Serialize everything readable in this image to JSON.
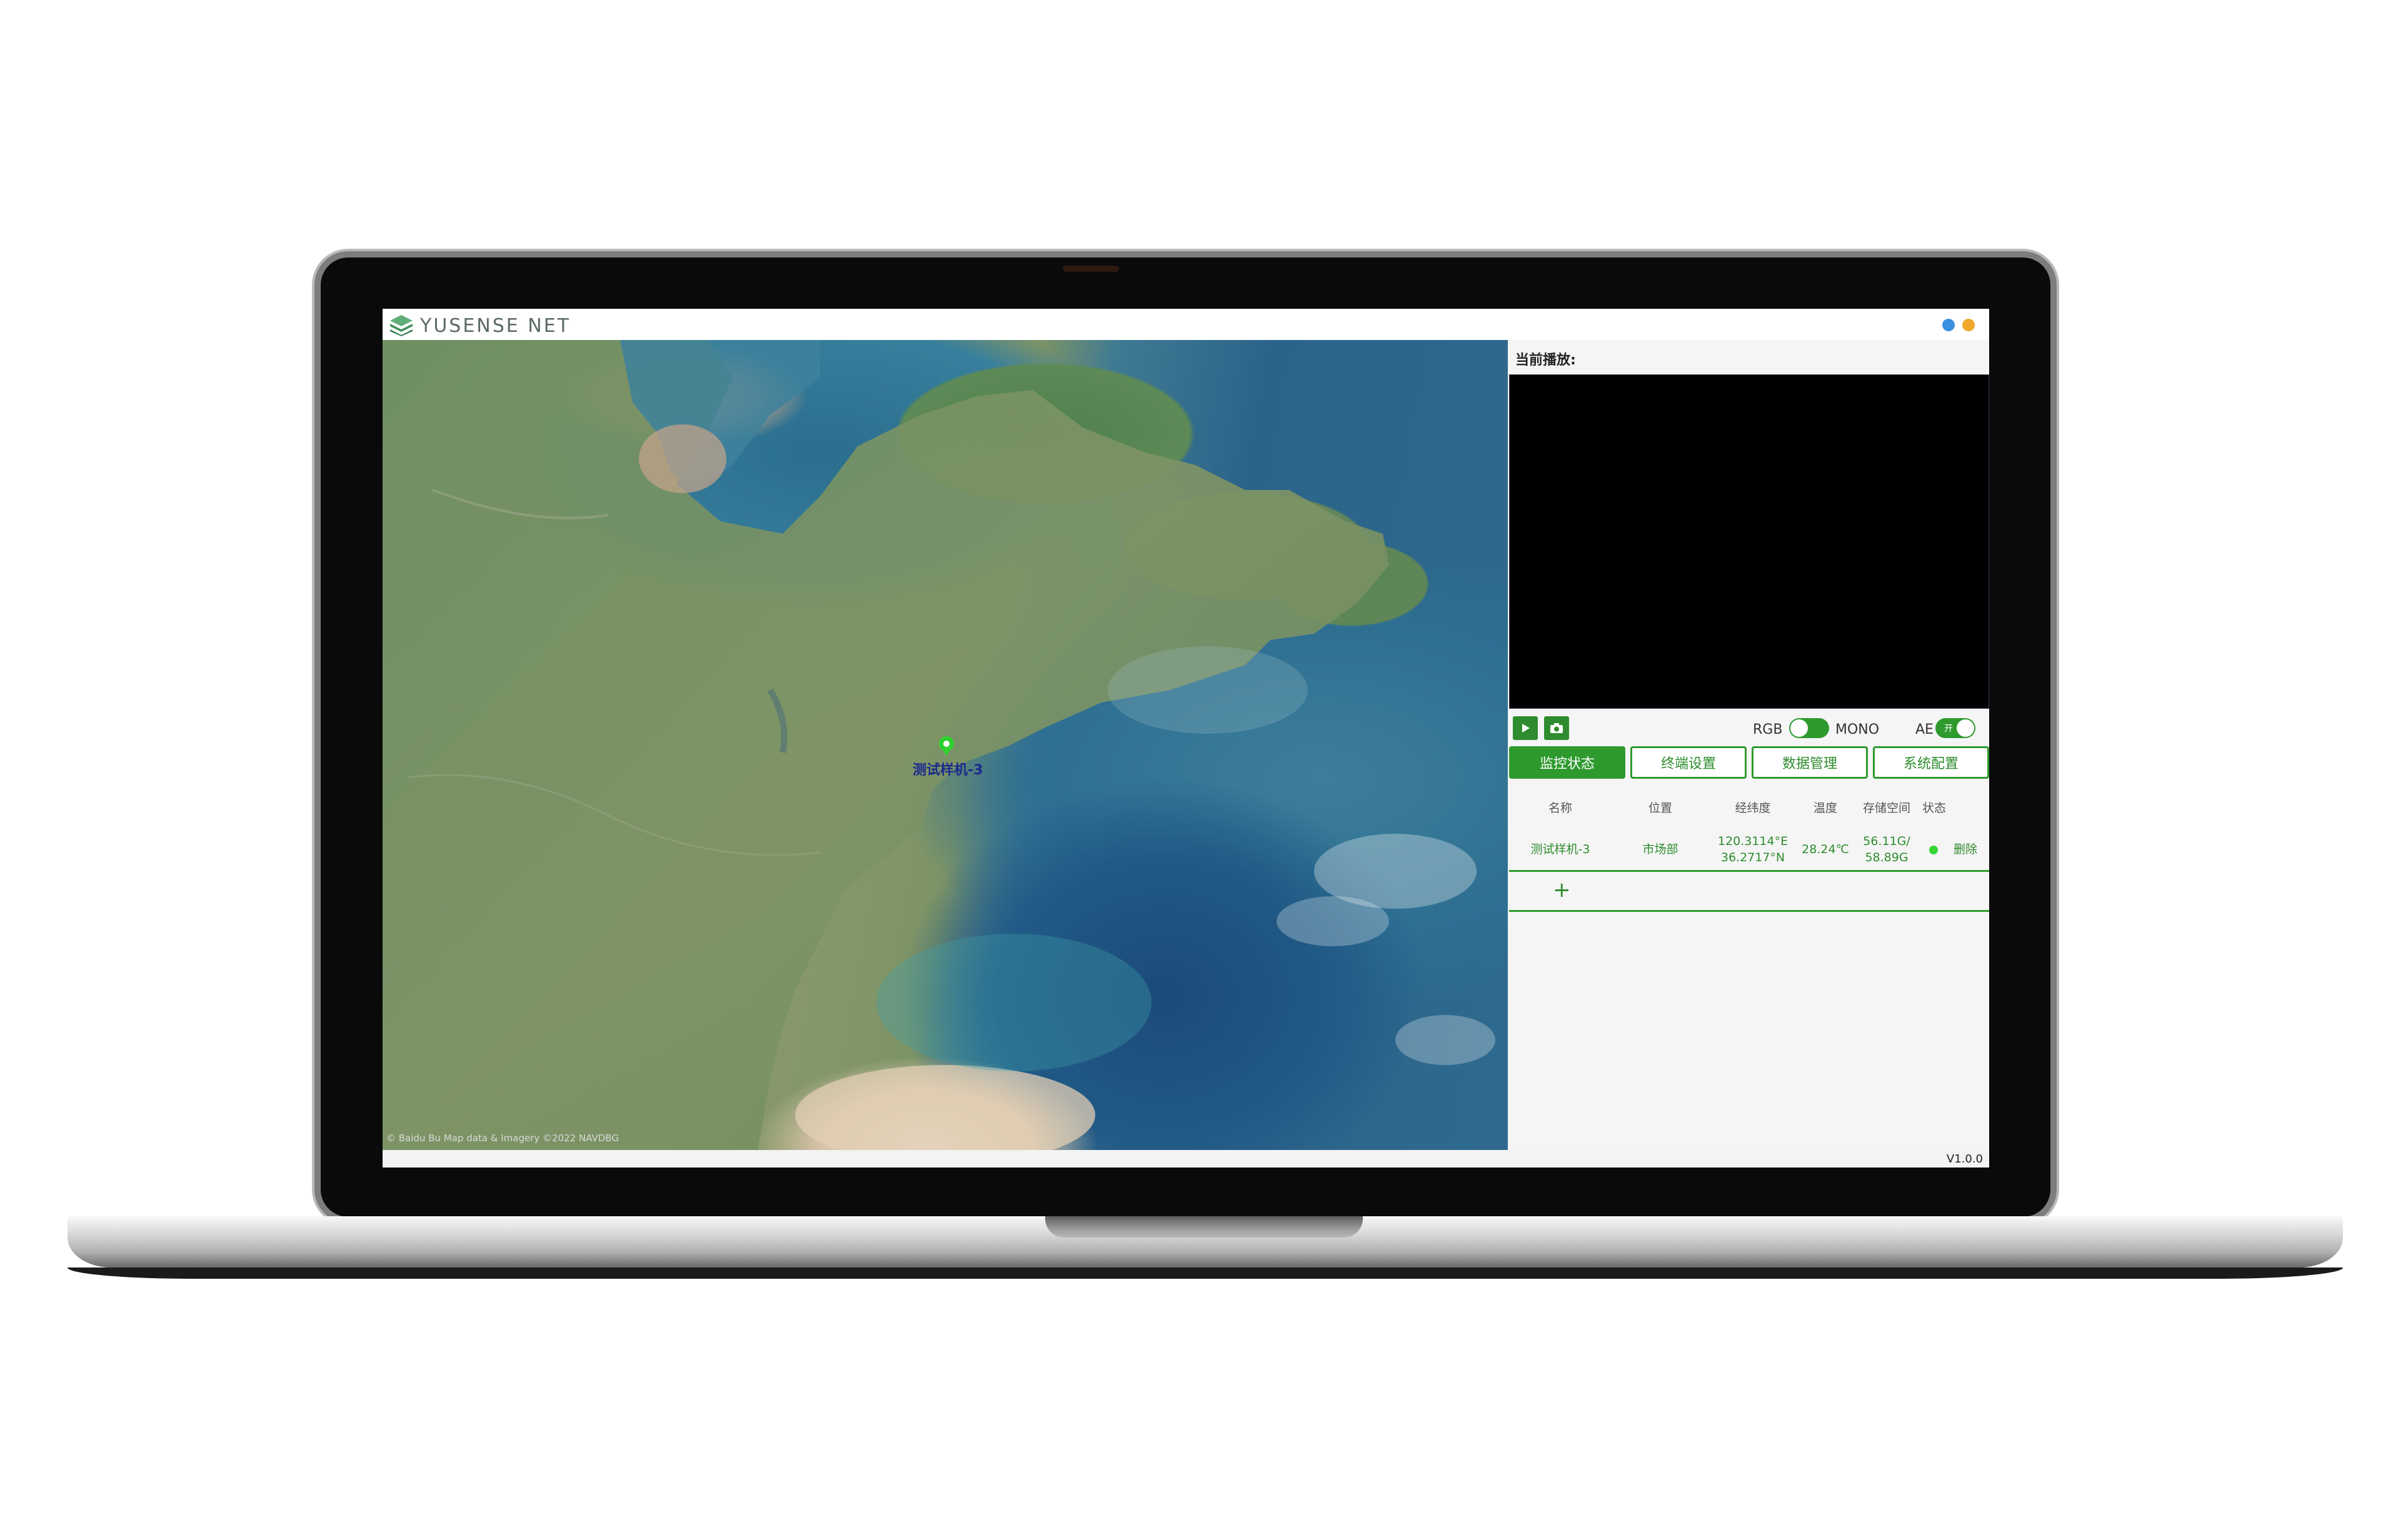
{
  "app": {
    "title": "YUSENSE NET",
    "version": "V1.0.0"
  },
  "map": {
    "marker_label": "测试样机-3",
    "copyright": "© Baidu  Bu   Map data & Imagery ©2022 NAVDBG"
  },
  "panel": {
    "now_playing_label": "当前播放:",
    "controls": {
      "play_icon": "play-icon",
      "snapshot_icon": "camera-icon",
      "rgb_label": "RGB",
      "mono_label": "MONO",
      "mono_on": true,
      "ae_label": "AE",
      "ae_toggle_text": "开",
      "ae_on": true
    },
    "tabs": [
      {
        "label": "监控状态",
        "active": true
      },
      {
        "label": "终端设置",
        "active": false
      },
      {
        "label": "数据管理",
        "active": false
      },
      {
        "label": "系统配置",
        "active": false
      }
    ],
    "table": {
      "headers": [
        "名称",
        "位置",
        "经纬度",
        "温度",
        "存储空间",
        "状态"
      ],
      "rows": [
        {
          "name": "测试样机-3",
          "location": "市场部",
          "lon": "120.3114°E",
          "lat": "36.2717°N",
          "temperature": "28.24℃",
          "storage_used": "56.11G/",
          "storage_total": "58.89G",
          "status": "online",
          "action": "删除"
        }
      ],
      "add_label": "+"
    }
  },
  "colors": {
    "accent": "#2e9a2e",
    "status_online": "#33d633"
  }
}
